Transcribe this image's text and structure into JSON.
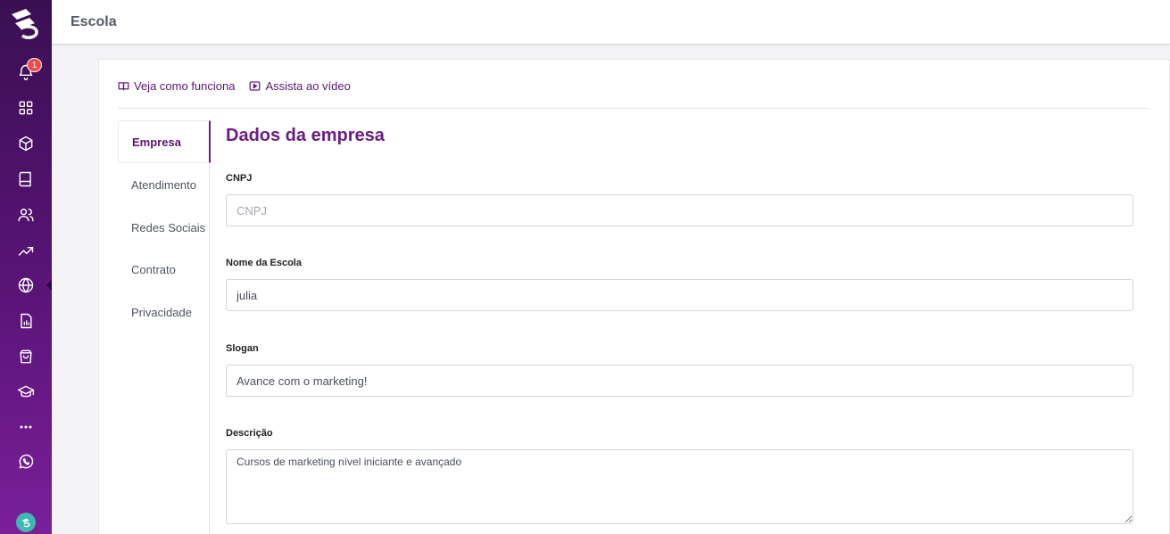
{
  "header": {
    "title": "Escola"
  },
  "sidebar": {
    "logo": "brand-logo",
    "notification_count": "1",
    "items": [
      {
        "name": "bell-icon"
      },
      {
        "name": "grid-icon"
      },
      {
        "name": "cube-icon"
      },
      {
        "name": "book-icon"
      },
      {
        "name": "users-icon"
      },
      {
        "name": "trending-up-icon"
      },
      {
        "name": "globe-icon"
      },
      {
        "name": "report-icon"
      },
      {
        "name": "shopping-bag-icon"
      },
      {
        "name": "graduation-cap-icon"
      },
      {
        "name": "more-icon"
      },
      {
        "name": "whatsapp-icon"
      }
    ]
  },
  "help": {
    "how_it_works": "Veja como funciona",
    "watch_video": "Assista ao vídeo"
  },
  "tabs": [
    {
      "label": "Empresa",
      "active": true
    },
    {
      "label": "Atendimento",
      "active": false
    },
    {
      "label": "Redes Sociais",
      "active": false
    },
    {
      "label": "Contrato",
      "active": false
    },
    {
      "label": "Privacidade",
      "active": false
    }
  ],
  "form": {
    "title": "Dados da empresa",
    "cnpj": {
      "label": "CNPJ",
      "placeholder": "CNPJ",
      "value": ""
    },
    "school_name": {
      "label": "Nome da Escola",
      "value": "julia"
    },
    "slogan": {
      "label": "Slogan",
      "value": "Avance com o marketing!"
    },
    "description": {
      "label": "Descrição",
      "value": "Cursos de marketing nível iniciante e avançado"
    }
  },
  "colors": {
    "primary": "#6a1d82",
    "sidebar_top": "#3a0f52",
    "sidebar_bottom": "#7a1f9a",
    "badge": "#f04b4b"
  }
}
